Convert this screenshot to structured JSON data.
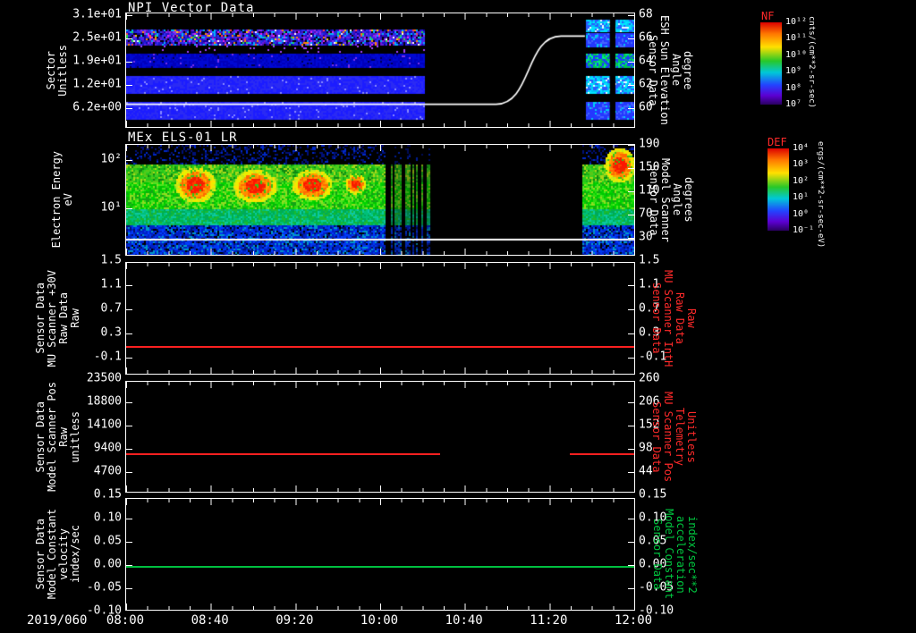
{
  "colors": {
    "background": "#000000",
    "foreground": "#ffffff",
    "red_series": "#ff2020",
    "green_series": "#00c040",
    "red_label": "#ff2a2a",
    "green_label": "#00c840",
    "colorbar_title": "#ff2a2a"
  },
  "xaxis": {
    "date_label": "2019/060",
    "ticks": [
      "08:00",
      "08:40",
      "09:20",
      "10:00",
      "10:40",
      "11:20",
      "12:00"
    ]
  },
  "panels": [
    {
      "title": "NPI Vector Data",
      "left_label_lines": [
        "Sector",
        "Unitless"
      ],
      "left_ticks": [
        "3.1e+01",
        "2.5e+01",
        "1.9e+01",
        "1.2e+01",
        "6.2e+00"
      ],
      "right_label_lines": [
        "Sensor Data",
        "ESH Sun Elevation",
        "Angle",
        "degree"
      ],
      "right_ticks": [
        "68",
        "66",
        "64",
        "62",
        "60"
      ],
      "colorbar": {
        "title": "NF",
        "ticks": [
          "10¹²",
          "10¹¹",
          "10¹⁰",
          "10⁹",
          "10⁸",
          "10⁷"
        ],
        "units": "cnts/(cm**2-sr-sec)"
      }
    },
    {
      "title": "MEx ELS-01 LR",
      "left_label_lines": [
        "Electron Energy",
        "eV"
      ],
      "left_ticks": [
        "10²",
        "10¹"
      ],
      "right_label_lines": [
        "Sensor Data",
        "Model Scanner",
        "Angle",
        "degrees"
      ],
      "right_ticks": [
        "190",
        "150",
        "110",
        "70",
        "30"
      ],
      "colorbar": {
        "title": "DEF",
        "ticks": [
          "10⁴",
          "10³",
          "10²",
          "10¹",
          "10⁰",
          "10⁻¹"
        ],
        "units": "ergs/(cm**2-sr-sec-eV)"
      }
    },
    {
      "left_label_lines": [
        "Sensor Data",
        "MU Scanner +30V",
        "Raw Data",
        "Raw"
      ],
      "left_ticks": [
        "1.5",
        "1.1",
        "0.7",
        "0.3",
        "-0.1"
      ],
      "right_label_lines": [
        "Sensor Data",
        "MU Scanner IntH",
        "Raw Data",
        "Raw"
      ],
      "right_ticks": [
        "1.5",
        "1.1",
        "0.7",
        "0.3",
        "-0.1"
      ]
    },
    {
      "left_label_lines": [
        "Sensor Data",
        "Model Scanner Pos",
        "Raw",
        "unitless"
      ],
      "left_ticks": [
        "23500",
        "18800",
        "14100",
        "9400",
        "4700"
      ],
      "right_label_lines": [
        "Sensor Data",
        "MU Scanner Pos",
        "Telemetry",
        "Unitless"
      ],
      "right_ticks": [
        "260",
        "206",
        "152",
        "98",
        "44"
      ]
    },
    {
      "left_label_lines": [
        "Sensor Data",
        "Model Constant",
        "velocity",
        "index/sec"
      ],
      "left_ticks": [
        "0.15",
        "0.10",
        "0.05",
        "0.00",
        "-0.05",
        "-0.10"
      ],
      "right_label_lines": [
        "Sensor Data",
        "Model Constant",
        "acceleration",
        "index/sec**2"
      ],
      "right_ticks": [
        "0.15",
        "0.10",
        "0.05",
        "0.00",
        "-0.05",
        "-0.10"
      ]
    }
  ],
  "chart_data": [
    {
      "type": "heatmap",
      "title": "NPI Vector Data",
      "xlabel": "Time 2019/060 08:00 - 12:00",
      "ylabel": "Sector Unitless",
      "yticks": [
        6.2,
        12,
        19,
        25,
        31
      ],
      "y2label": "Sensor Data ESH Sun Elevation Angle degree",
      "y2ticks": [
        60,
        62,
        64,
        66,
        68
      ],
      "colorbar": {
        "name": "NF",
        "units": "cnts/(cm**2-sr-sec)",
        "scale": "log",
        "min": "1e7",
        "max": "1e12"
      },
      "data_intervals": [
        [
          "08:00",
          "10:21"
        ],
        [
          "11:27",
          "12:00"
        ]
      ],
      "description": "Blue/purple sector count-rate bands with a noisy multicolour band near sectors 23-27; sparse purple specks below it; bright blue/cyan blocks after data resumes at 11:27.",
      "overlay_line": {
        "name": "sun-elevation-angle",
        "units": "degree",
        "points": [
          [
            "08:00",
            60.2
          ],
          [
            "10:55",
            60.2
          ],
          [
            "11:03",
            61.5
          ],
          [
            "11:08",
            63.5
          ],
          [
            "11:13",
            65.3
          ],
          [
            "11:20",
            66.2
          ],
          [
            "11:27",
            66.2
          ]
        ]
      },
      "render": {
        "gap_x": [
          0.588,
          0.903
        ],
        "bands": [
          {
            "y": [
              0.142,
              0.276
            ],
            "style": "noise_multi"
          },
          {
            "y": [
              0.29,
              0.335
            ],
            "style": "sparse_purple"
          },
          {
            "y": [
              0.357,
              0.465
            ],
            "style": "blue_dark"
          },
          {
            "y": [
              0.558,
              0.7
            ],
            "style": "blue_mid"
          },
          {
            "y": [
              0.787,
              0.93
            ],
            "style": "blue_mid"
          }
        ],
        "resume_bands": [
          {
            "y": [
              0.06,
              0.165
            ],
            "style": "cyan_blue"
          },
          {
            "y": [
              0.175,
              0.285
            ],
            "style": "blue_bright"
          },
          {
            "y": [
              0.357,
              0.465
            ],
            "style": "blue_green"
          },
          {
            "y": [
              0.558,
              0.7
            ],
            "style": "cyan_blue"
          },
          {
            "y": [
              0.787,
              0.93
            ],
            "style": "blue_bright"
          }
        ],
        "resume_dark_col": [
          0.952,
          0.963
        ],
        "line_flat_y": 0.8,
        "line_top_y": 0.2,
        "line_rise_x": [
          0.728,
          0.856
        ]
      }
    },
    {
      "type": "heatmap",
      "title": "MEx ELS-01 LR",
      "ylabel": "Electron Energy eV",
      "yscale": "log",
      "yticks": [
        10,
        100
      ],
      "y2label": "Sensor Data Model Scanner Angle degrees",
      "y2ticks": [
        30,
        70,
        110,
        150,
        190
      ],
      "colorbar": {
        "name": "DEF",
        "units": "ergs/(cm**2-sr-sec-eV)",
        "scale": "log",
        "min": "1e-1",
        "max": "1e4"
      },
      "data_intervals": [
        [
          "08:00",
          "10:22"
        ],
        [
          "11:26",
          "12:00"
        ]
      ],
      "description": "Broad 10-100 eV electron flux (green) with intense red-orange patches near 20-60 eV around 08:25, 08:55 and 09:20; ragged striped flux 10:05-10:22; renewed flux after 11:26 with an intense high-energy patch just before 12:00; white marker line near 6 eV across the full interval.",
      "render": {
        "gap_x": [
          0.596,
          0.895
        ],
        "stripe_x": [
          0.509,
          0.596
        ],
        "bands": [
          {
            "y": [
              0.0,
              0.17
            ],
            "style": "dark_sparse"
          },
          {
            "y": [
              0.17,
              0.34
            ],
            "style": "green_mid"
          },
          {
            "y": [
              0.34,
              0.58
            ],
            "style": "green_bright"
          },
          {
            "y": [
              0.58,
              0.72
            ],
            "style": "green_cyan"
          },
          {
            "y": [
              0.72,
              1.0
            ],
            "style": "blue_noise"
          }
        ],
        "blobs": [
          {
            "x": [
              0.095,
              0.175
            ],
            "y": [
              0.2,
              0.52
            ]
          },
          {
            "x": [
              0.21,
              0.295
            ],
            "y": [
              0.22,
              0.52
            ]
          },
          {
            "x": [
              0.325,
              0.405
            ],
            "y": [
              0.22,
              0.5
            ]
          },
          {
            "x": [
              0.43,
              0.47
            ],
            "y": [
              0.26,
              0.44
            ]
          }
        ],
        "resume_blob": {
          "x": [
            0.94,
            1.0
          ],
          "y": [
            0.02,
            0.34
          ]
        },
        "white_line_y": 0.856
      }
    },
    {
      "type": "line",
      "ylabel": "Sensor Data MU Scanner +30V Raw Data Raw",
      "y2label": "Sensor Data MU Scanner IntH Raw Data Raw",
      "yticks": [
        -0.1,
        0.3,
        0.7,
        1.1,
        1.5
      ],
      "ylim": [
        -0.4,
        1.53
      ],
      "series": [
        {
          "name": "MU Scanner +30V Raw",
          "color": "#ff2020",
          "constant_value": 0.1,
          "intervals": [
            [
              "08:00",
              "12:00"
            ]
          ]
        }
      ]
    },
    {
      "type": "line",
      "ylabel": "Sensor Data Model Scanner Pos Raw unitless",
      "y2label": "Sensor Data MU Scanner Pos Telemetry Unitless",
      "yticks": [
        4700,
        9400,
        14100,
        18800,
        23500
      ],
      "y2ticks": [
        44,
        98,
        152,
        206,
        260
      ],
      "ylim": [
        300,
        24000
      ],
      "series": [
        {
          "name": "Model Scanner Pos Raw",
          "color": "#ff2020",
          "constant_value": 8300,
          "intervals": [
            [
              "08:00",
              "10:28"
            ],
            [
              "11:29",
              "12:00"
            ]
          ]
        }
      ]
    },
    {
      "type": "line",
      "ylabel": "Sensor Data Model Constant velocity index/sec",
      "y2label": "Sensor Data Model Constant acceleration index/sec**2",
      "yticks": [
        -0.1,
        -0.05,
        0.0,
        0.05,
        0.1,
        0.15
      ],
      "ylim": [
        -0.1,
        0.15
      ],
      "series": [
        {
          "name": "Model Constant velocity",
          "color": "#00c040",
          "constant_value": 0.0,
          "intervals": [
            [
              "08:00",
              "12:00"
            ]
          ]
        }
      ]
    }
  ]
}
